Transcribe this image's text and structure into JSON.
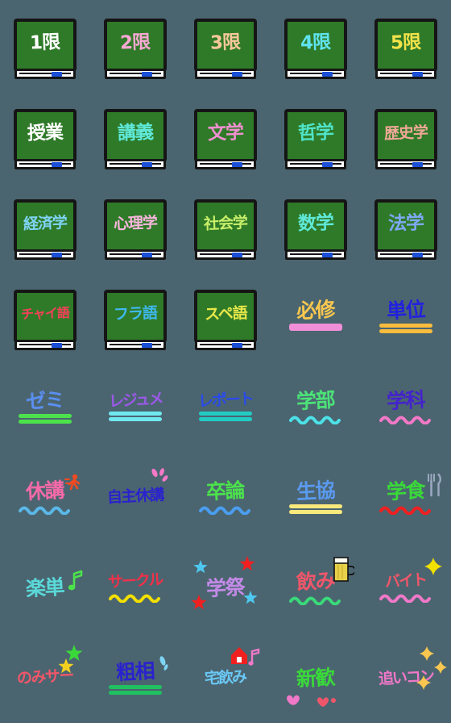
{
  "page": {
    "title": "University Life Emoji Pack",
    "background_color": "#4b6570",
    "grid_columns": 5,
    "grid_rows": 8,
    "total_stickers": 40
  },
  "palette": {
    "board_green": "#2f7a28",
    "board_frame": "#151515",
    "tray_white": "#ffffff",
    "eraser_blue": "#1b4fd8",
    "background": "#4b6570"
  },
  "stickers": [
    {
      "id": 1,
      "text": "1限",
      "type": "chalkboard",
      "text_color": "#ffffff",
      "name": "period-1"
    },
    {
      "id": 2,
      "text": "2限",
      "type": "chalkboard",
      "text_color": "#f9a8d4",
      "name": "period-2"
    },
    {
      "id": 3,
      "text": "3限",
      "type": "chalkboard",
      "text_color": "#f8c89a",
      "name": "period-3"
    },
    {
      "id": 4,
      "text": "4限",
      "type": "chalkboard",
      "text_color": "#5fe3f0",
      "name": "period-4"
    },
    {
      "id": 5,
      "text": "5限",
      "type": "chalkboard",
      "text_color": "#f2e24a",
      "name": "period-5"
    },
    {
      "id": 6,
      "text": "授業",
      "type": "chalkboard",
      "text_color": "#ffffff",
      "name": "class"
    },
    {
      "id": 7,
      "text": "講義",
      "type": "chalkboard",
      "text_color": "#5fe8d8",
      "name": "lecture"
    },
    {
      "id": 8,
      "text": "文学",
      "type": "chalkboard",
      "text_color": "#f08fd0",
      "name": "literature"
    },
    {
      "id": 9,
      "text": "哲学",
      "type": "chalkboard",
      "text_color": "#4fe3c8",
      "name": "philosophy"
    },
    {
      "id": 10,
      "text": "歴史学",
      "type": "chalkboard",
      "text_color": "#f0a898",
      "name": "history",
      "size": "sz-3"
    },
    {
      "id": 11,
      "text": "経済学",
      "type": "chalkboard",
      "text_color": "#7fd4f5",
      "name": "economics",
      "size": "sz-3"
    },
    {
      "id": 12,
      "text": "心理学",
      "type": "chalkboard",
      "text_color": "#f9b6dd",
      "name": "psychology",
      "size": "sz-3"
    },
    {
      "id": 13,
      "text": "社会学",
      "type": "chalkboard",
      "text_color": "#c8ef6a",
      "name": "sociology",
      "size": "sz-3"
    },
    {
      "id": 14,
      "text": "数学",
      "type": "chalkboard",
      "text_color": "#5fe8d8",
      "name": "mathematics"
    },
    {
      "id": 15,
      "text": "法学",
      "type": "chalkboard",
      "text_color": "#7fa8f5",
      "name": "law"
    },
    {
      "id": 16,
      "text": "チャイ語",
      "type": "chalkboard",
      "text_color": "#f2415a",
      "name": "chinese-language",
      "size": "sz-4"
    },
    {
      "id": 17,
      "text": "フラ語",
      "type": "chalkboard",
      "text_color": "#3fb8ef",
      "name": "french-language",
      "size": "sz-3"
    },
    {
      "id": 18,
      "text": "スペ語",
      "type": "chalkboard",
      "text_color": "#e8e84a",
      "name": "spanish-language",
      "size": "sz-3"
    },
    {
      "id": 19,
      "text": "必修",
      "type": "plain",
      "text_color": "#f9c74f",
      "name": "required-course",
      "deco": {
        "kind": "bar-thick",
        "color": "#f08fd8"
      }
    },
    {
      "id": 20,
      "text": "単位",
      "type": "plain",
      "text_color": "#2222dd",
      "name": "credits",
      "deco": {
        "kind": "bar-double",
        "color": "#f9bc3c"
      }
    },
    {
      "id": 21,
      "text": "ゼミ",
      "type": "plain",
      "text_color": "#5a8ff0",
      "name": "seminar",
      "deco": {
        "kind": "bar-double",
        "color": "#4ce24c"
      }
    },
    {
      "id": 22,
      "text": "レジュメ",
      "type": "plain",
      "text_color": "#9b59e8",
      "name": "handout",
      "size": "sz-4",
      "deco": {
        "kind": "bar-double",
        "color": "#6fe8ef"
      }
    },
    {
      "id": 23,
      "text": "レポート",
      "type": "plain",
      "text_color": "#2a4be8",
      "name": "report",
      "size": "sz-4",
      "deco": {
        "kind": "bar-double",
        "color": "#22ccc4"
      }
    },
    {
      "id": 24,
      "text": "学部",
      "type": "plain",
      "text_color": "#4ce278",
      "name": "faculty",
      "deco": {
        "kind": "wave",
        "color": "#4ce2e8"
      }
    },
    {
      "id": 25,
      "text": "学科",
      "type": "plain",
      "text_color": "#4422cc",
      "name": "department",
      "deco": {
        "kind": "wave",
        "color": "#f578c8"
      }
    },
    {
      "id": 26,
      "text": "休講",
      "type": "plain",
      "text_color": "#f56aa8",
      "name": "class-cancelled",
      "deco": {
        "kind": "wave",
        "color": "#5ab8e8"
      },
      "accent": "running-person",
      "accent_color": "#f04a22"
    },
    {
      "id": 27,
      "text": "自主休講",
      "type": "plain",
      "text_color": "#2a22cc",
      "name": "self-cancelled-class",
      "two_line": true,
      "accent": "sweat-drops",
      "accent_color": "#f578c8"
    },
    {
      "id": 28,
      "text": "卒論",
      "type": "plain",
      "text_color": "#4ce24c",
      "name": "graduation-thesis",
      "deco": {
        "kind": "wave",
        "color": "#4a9ef0"
      }
    },
    {
      "id": 29,
      "text": "生協",
      "type": "plain",
      "text_color": "#5a9af0",
      "name": "co-op",
      "deco": {
        "kind": "bar-double",
        "color": "#f9e87c"
      }
    },
    {
      "id": 30,
      "text": "学食",
      "type": "plain",
      "text_color": "#3ad93a",
      "name": "cafeteria",
      "deco": {
        "kind": "wave",
        "color": "#f02020"
      },
      "accent": "fork-knife",
      "accent_color": "#9aa8c0"
    },
    {
      "id": 31,
      "text": "楽単",
      "type": "plain",
      "text_color": "#5ad8d8",
      "name": "easy-credit",
      "accent": "music-note",
      "accent_color": "#4ce24c"
    },
    {
      "id": 32,
      "text": "サークル",
      "type": "plain",
      "text_color": "#f0304a",
      "name": "club",
      "size": "sz-4",
      "deco": {
        "kind": "wave",
        "color": "#f2e000"
      }
    },
    {
      "id": 33,
      "text": "学祭",
      "type": "plain",
      "text_color": "#c48ae8",
      "name": "school-festival",
      "accent": "stars-red-blue",
      "accent_color": "#f02020"
    },
    {
      "id": 34,
      "text": "飲み",
      "type": "plain",
      "text_color": "#f0566a",
      "name": "drinking-party",
      "deco": {
        "kind": "wave",
        "color": "#3ad97a"
      },
      "accent": "beer-mug",
      "accent_color": "#e8d24a"
    },
    {
      "id": 35,
      "text": "バイト",
      "type": "plain",
      "text_color": "#f0566a",
      "name": "part-time-job",
      "size": "sz-4",
      "deco": {
        "kind": "wave",
        "color": "#f078c8"
      },
      "accent": "sparkle-yellow",
      "accent_color": "#f2e000"
    },
    {
      "id": 36,
      "text": "のみサー",
      "type": "plain",
      "text_color": "#f0566a",
      "name": "drinking-circle",
      "two_line": true,
      "accent": "stars-green-yellow",
      "accent_color": "#3ad93a"
    },
    {
      "id": 37,
      "text": "粗相",
      "type": "plain",
      "text_color": "#2a22cc",
      "name": "blunder",
      "deco": {
        "kind": "bar-double",
        "color": "#20c060"
      },
      "accent": "sweat-drop-blue",
      "accent_color": "#7fd4f5"
    },
    {
      "id": 38,
      "text": "宅飲み",
      "type": "plain",
      "text_color": "#6ac8f5",
      "name": "home-drinking",
      "size": "sz-4",
      "accent": "house-note",
      "accent_color": "#f02020"
    },
    {
      "id": 39,
      "text": "新歓",
      "type": "plain",
      "text_color": "#3ad93a",
      "name": "welcome-party",
      "accent": "ribbon-pink",
      "accent_color": "#f078c8"
    },
    {
      "id": 40,
      "text": "追いコン",
      "type": "plain",
      "text_color": "#f078c8",
      "name": "farewell-party",
      "size": "sz-4",
      "accent": "sparkles-gold",
      "accent_color": "#f9c74f"
    }
  ]
}
